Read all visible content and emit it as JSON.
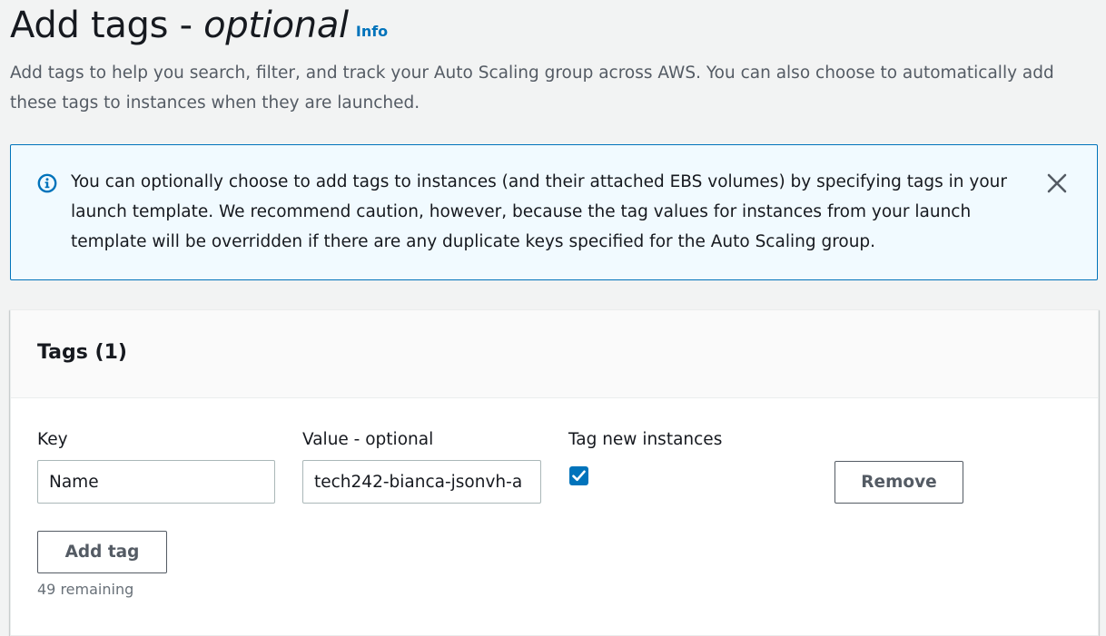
{
  "header": {
    "title_main": "Add tags -",
    "title_emph": "optional",
    "info_link": "Info",
    "description": "Add tags to help you search, filter, and track your Auto Scaling group across AWS. You can also choose to automatically add these tags to instances when they are launched."
  },
  "alert": {
    "icon": "info-circle-icon",
    "message": "You can optionally choose to add tags to instances (and their attached EBS volumes) by specifying tags in your launch template. We recommend caution, however, because the tag values for instances from your launch template will be overridden if there are any duplicate keys specified for the Auto Scaling group.",
    "close_icon": "close-icon",
    "color_border": "#0073bb",
    "color_background": "#f1faff"
  },
  "tags_panel": {
    "title": "Tags (1)",
    "columns": {
      "key": "Key",
      "value": "Value - optional",
      "propagate": "Tag new instances"
    },
    "rows": [
      {
        "key": "Name",
        "value": "tech242-bianca-jsonvh-a",
        "tag_new_instances": true,
        "remove_label": "Remove"
      }
    ],
    "add_tag_label": "Add tag",
    "remaining_text": "49 remaining"
  },
  "colors": {
    "accent": "#0073bb",
    "page_background": "#f2f3f3",
    "secondary_text": "#545b64"
  }
}
